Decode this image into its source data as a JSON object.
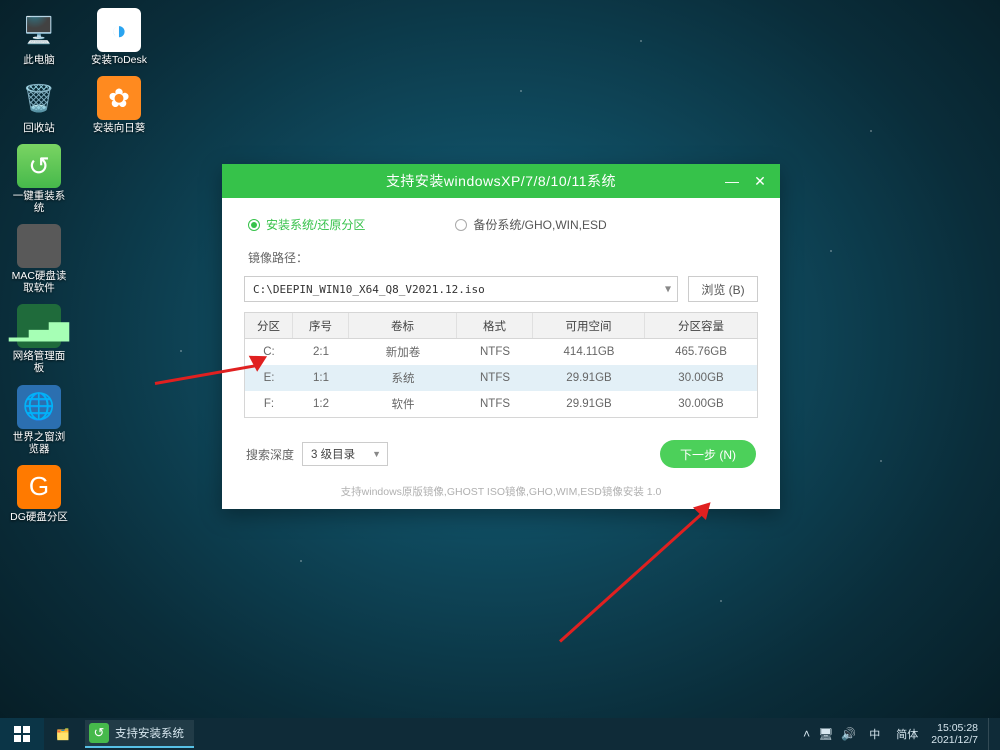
{
  "desktop": {
    "col1": [
      {
        "label": "此电脑"
      },
      {
        "label": "回收站"
      },
      {
        "label": "一键重装系统"
      },
      {
        "label": "MAC硬盘读取软件"
      },
      {
        "label": "网络管理面板"
      },
      {
        "label": "世界之窗浏览器"
      },
      {
        "label": "DG硬盘分区"
      }
    ],
    "col2": [
      {
        "label": "安装ToDesk"
      },
      {
        "label": "安装向日葵"
      }
    ]
  },
  "modal": {
    "title": "支持安装windowsXP/7/8/10/11系统",
    "radio_install": "安装系统/还原分区",
    "radio_backup": "备份系统/GHO,WIN,ESD",
    "path_label": "镜像路径：",
    "path_value": "C:\\DEEPIN_WIN10_X64_Q8_V2021.12.iso",
    "browse": "浏览 (B)",
    "columns": {
      "c0": "分区",
      "c1": "序号",
      "c2": "卷标",
      "c3": "格式",
      "c4": "可用空间",
      "c5": "分区容量"
    },
    "rows": [
      {
        "p": "C:",
        "n": "2:1",
        "v": "新加卷",
        "f": "NTFS",
        "free": "414.11GB",
        "cap": "465.76GB"
      },
      {
        "p": "E:",
        "n": "1:1",
        "v": "系统",
        "f": "NTFS",
        "free": "29.91GB",
        "cap": "30.00GB"
      },
      {
        "p": "F:",
        "n": "1:2",
        "v": "软件",
        "f": "NTFS",
        "free": "29.91GB",
        "cap": "30.00GB"
      }
    ],
    "depth_label": "搜索深度",
    "depth_value": "3 级目录",
    "next": "下一步 (N)",
    "footer": "支持windows原版镜像,GHOST ISO镜像,GHO,WIM,ESD镜像安装    1.0"
  },
  "taskbar": {
    "app": "支持安装系统",
    "ime1": "中",
    "ime2": "简体",
    "time": "15:05:28",
    "date": "2021/12/7"
  }
}
